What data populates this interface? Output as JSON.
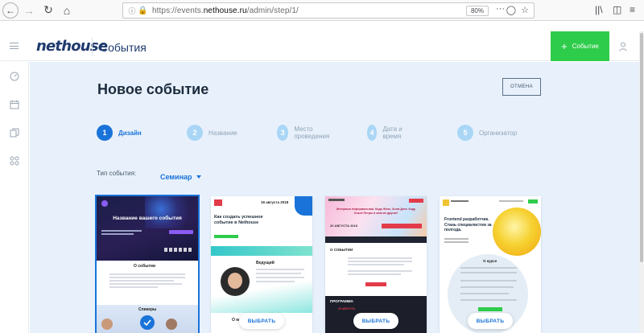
{
  "browser": {
    "url_prefix": "https://events.",
    "url_host": "nethouse.ru",
    "url_path": "/admin/step/1/",
    "zoom": "80%",
    "more": "···"
  },
  "header": {
    "logo": "nethouse",
    "section": "События",
    "add_button": "Событие"
  },
  "page": {
    "title": "Новое событие",
    "cancel": "ОТМЕНА"
  },
  "steps": [
    {
      "num": "1",
      "label": "Дизайн"
    },
    {
      "num": "2",
      "label": "Название"
    },
    {
      "num": "3",
      "label": "Место проведения"
    },
    {
      "num": "4",
      "label": "Дата и время"
    },
    {
      "num": "5",
      "label": "Организатор"
    }
  ],
  "event_type": {
    "label": "Тип события:",
    "value": "Семинар"
  },
  "cards": [
    {
      "title": "Название вашего события",
      "section": "О событии",
      "speakers": "Спикеры"
    },
    {
      "date": "16 августа 2018",
      "title": "Как создать успешное событие в Nethouse",
      "leader": "Ведущий",
      "about": "О мастер-классе",
      "button": "ВЫБРАТЬ"
    },
    {
      "banner": "Интервью неформальная. Кода Жене, Холм Дега. Коду Ольга Петры и многие другие!",
      "date": "20 АВГУСТА 2018",
      "section": "О СОБЫТИИ",
      "program": "ПРОГРАММА",
      "date2": "20 АВГУСТА",
      "button": "ВЫБРАТЬ"
    },
    {
      "title": "Frontend разработчик. Стань специалистом за полгода.",
      "section": "О курсе",
      "button": "ВЫБРАТЬ"
    }
  ],
  "colors": {
    "accent": "#1a73d9",
    "green": "#2ecc4b",
    "navy": "#1f3a6e",
    "bg": "#e8f1fb"
  }
}
